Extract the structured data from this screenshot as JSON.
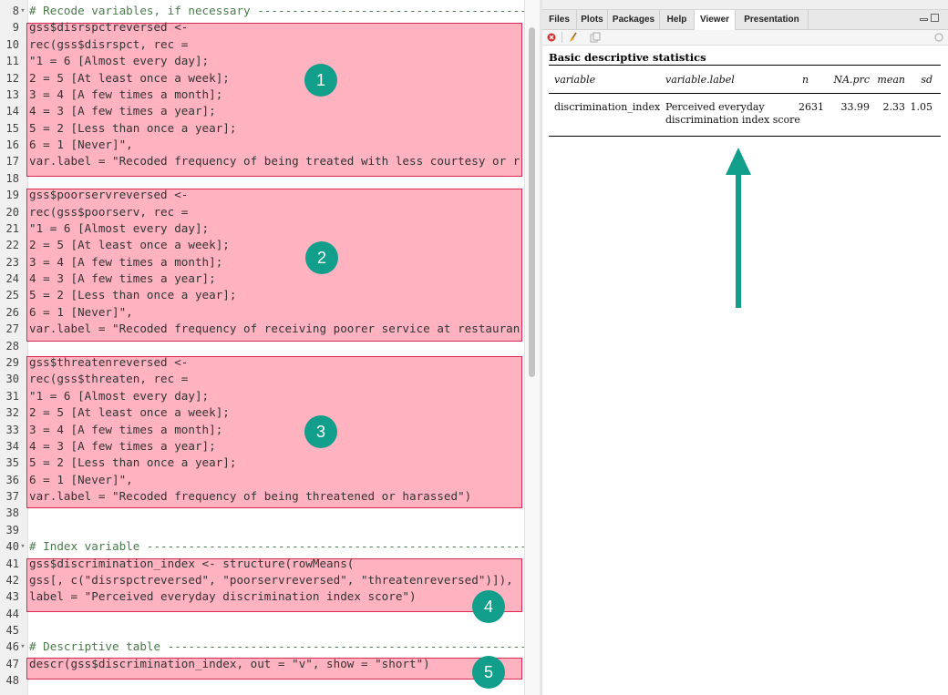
{
  "editor": {
    "lines": [
      {
        "n": "8",
        "fold": true,
        "text": "# Recode variables, if necessary --------------------------------------------",
        "comment": true
      },
      {
        "n": "9",
        "text": "gss$disrspctreversed <-"
      },
      {
        "n": "10",
        "text": "rec(gss$disrspct, rec ="
      },
      {
        "n": "11",
        "text": "\"1 = 6 [Almost every day];"
      },
      {
        "n": "12",
        "text": "2 = 5 [At least once a week];"
      },
      {
        "n": "13",
        "text": "3 = 4 [A few times a month];"
      },
      {
        "n": "14",
        "text": "4 = 3 [A few times a year];"
      },
      {
        "n": "15",
        "text": "5 = 2 [Less than once a year];"
      },
      {
        "n": "16",
        "text": "6 = 1 [Never]\","
      },
      {
        "n": "17",
        "text": "var.label = \"Recoded frequency of being treated with less courtesy or r"
      },
      {
        "n": "18",
        "text": ""
      },
      {
        "n": "19",
        "text": "gss$poorservreversed <-"
      },
      {
        "n": "20",
        "text": "rec(gss$poorserv, rec ="
      },
      {
        "n": "21",
        "text": "\"1 = 6 [Almost every day];"
      },
      {
        "n": "22",
        "text": "2 = 5 [At least once a week];"
      },
      {
        "n": "23",
        "text": "3 = 4 [A few times a month];"
      },
      {
        "n": "24",
        "text": "4 = 3 [A few times a year];"
      },
      {
        "n": "25",
        "text": "5 = 2 [Less than once a year];"
      },
      {
        "n": "26",
        "text": "6 = 1 [Never]\","
      },
      {
        "n": "27",
        "text": "var.label = \"Recoded frequency of receiving poorer service at restauran"
      },
      {
        "n": "28",
        "text": ""
      },
      {
        "n": "29",
        "text": "gss$threatenreversed <-"
      },
      {
        "n": "30",
        "text": "rec(gss$threaten, rec ="
      },
      {
        "n": "31",
        "text": "\"1 = 6 [Almost every day];"
      },
      {
        "n": "32",
        "text": "2 = 5 [At least once a week];"
      },
      {
        "n": "33",
        "text": "3 = 4 [A few times a month];"
      },
      {
        "n": "34",
        "text": "4 = 3 [A few times a year];"
      },
      {
        "n": "35",
        "text": "5 = 2 [Less than once a year];"
      },
      {
        "n": "36",
        "text": "6 = 1 [Never]\","
      },
      {
        "n": "37",
        "text": "var.label = \"Recoded frequency of being threatened or harassed\")"
      },
      {
        "n": "38",
        "text": ""
      },
      {
        "n": "39",
        "text": ""
      },
      {
        "n": "40",
        "fold": true,
        "text": "# Index variable --------------------------------------------------------------",
        "comment": true
      },
      {
        "n": "41",
        "text": "gss$discrimination_index <- structure(rowMeans("
      },
      {
        "n": "42",
        "text": "gss[, c(\"disrspctreversed\", \"poorservreversed\", \"threatenreversed\")]),"
      },
      {
        "n": "43",
        "text": "label = \"Perceived everyday discrimination index score\")"
      },
      {
        "n": "44",
        "text": ""
      },
      {
        "n": "45",
        "text": ""
      },
      {
        "n": "46",
        "fold": true,
        "text": "# Descriptive table -----------------------------------------------------------",
        "comment": true
      },
      {
        "n": "47",
        "text": "descr(gss$discrimination_index, out = \"v\", show = \"short\")"
      },
      {
        "n": "48",
        "text": ""
      }
    ],
    "badges": [
      "1",
      "2",
      "3",
      "4",
      "5"
    ]
  },
  "pane": {
    "tabs": [
      "Files",
      "Plots",
      "Packages",
      "Help",
      "Viewer",
      "Presentation"
    ],
    "active_tab": "Viewer"
  },
  "table": {
    "title": "Basic descriptive statistics",
    "headers": {
      "variable": "variable",
      "label": "variable.label",
      "n": "n",
      "naprc": "NA.prc",
      "mean": "mean",
      "sd": "sd"
    },
    "row": {
      "variable": "discrimination_index",
      "label_line1": "Perceived everyday",
      "label_line2": "discrimination index score",
      "n": "2631",
      "naprc": "33.99",
      "mean": "2.33",
      "sd": "1.05"
    }
  },
  "colors": {
    "accent_teal": "#119e8a",
    "highlight_fill": "#ffb3c1",
    "highlight_border": "#e0274f"
  }
}
